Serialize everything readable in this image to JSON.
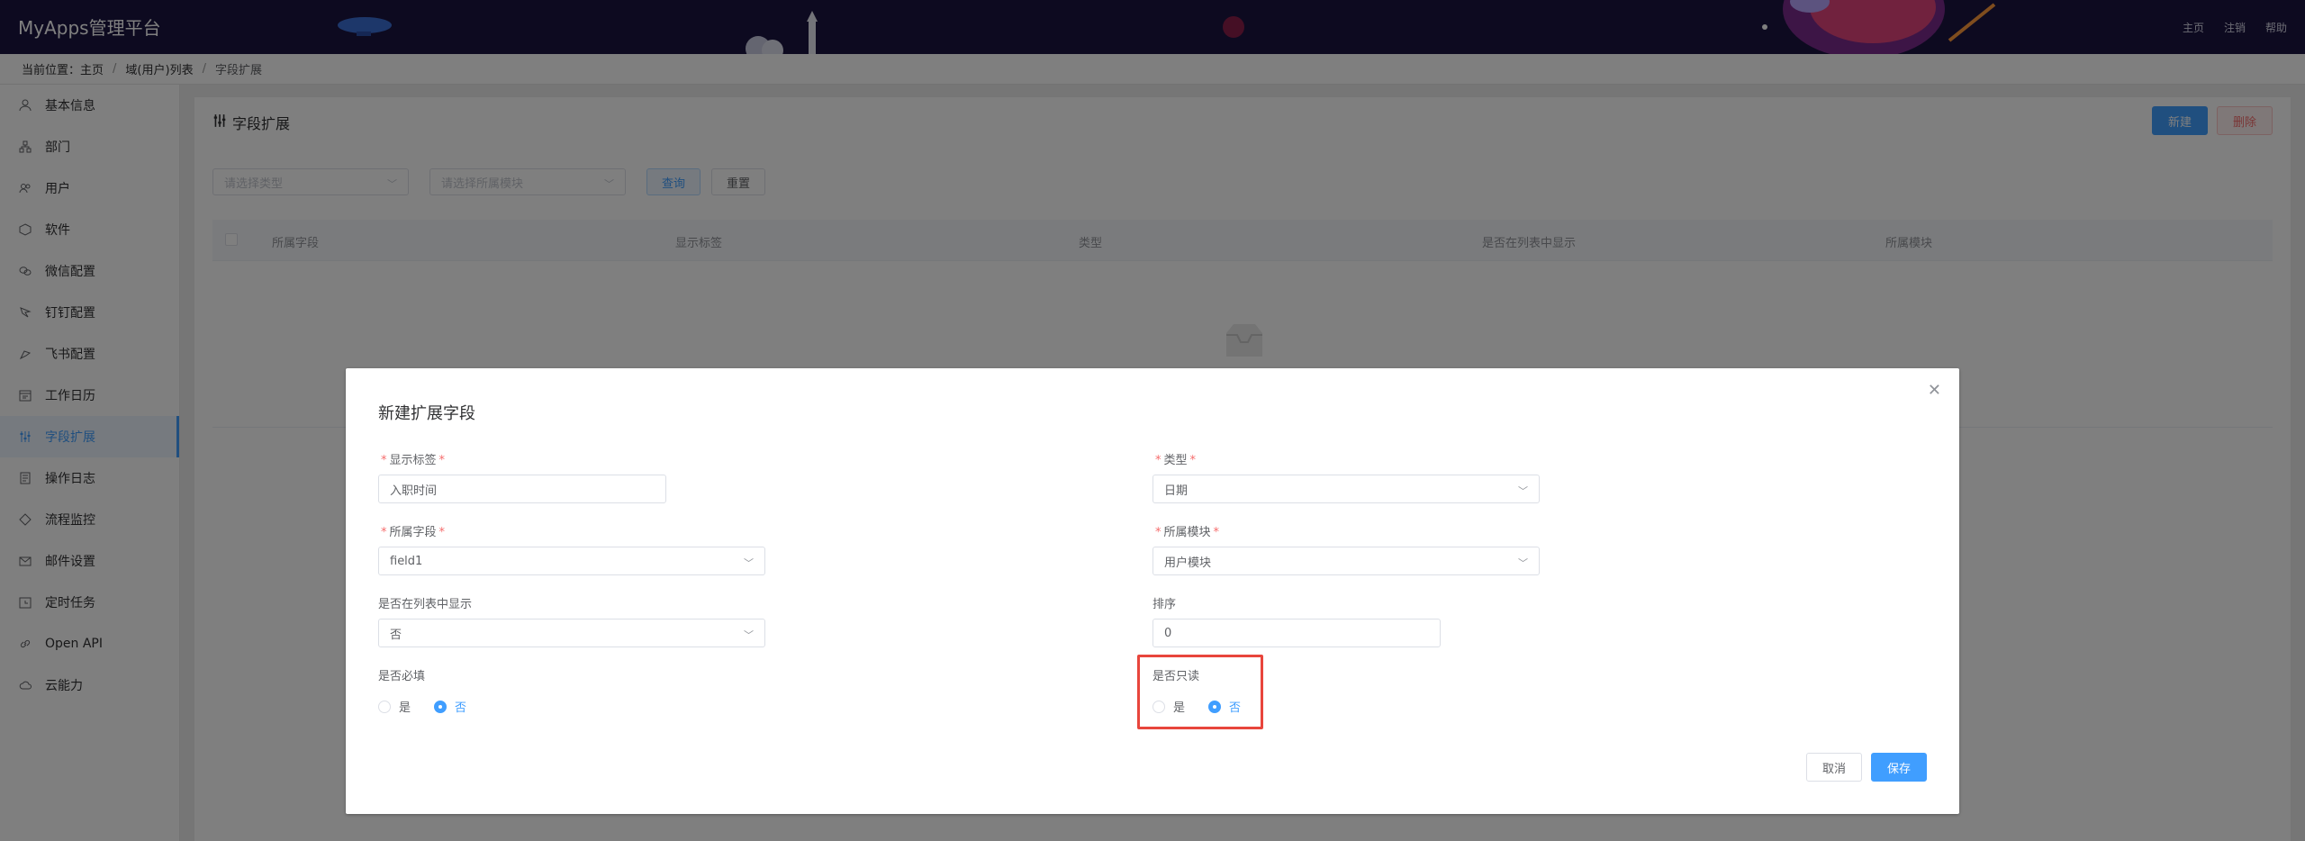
{
  "header": {
    "brand": "MyApps管理平台",
    "links": [
      "主页",
      "注销",
      "帮助"
    ]
  },
  "breadcrumb": {
    "prefix": "当前位置：",
    "items": [
      "主页",
      "域(用户)列表",
      "字段扩展"
    ]
  },
  "sidebar": {
    "items": [
      {
        "label": "基本信息",
        "icon": "person-icon"
      },
      {
        "label": "部门",
        "icon": "org-icon"
      },
      {
        "label": "用户",
        "icon": "users-icon"
      },
      {
        "label": "软件",
        "icon": "cube-icon"
      },
      {
        "label": "微信配置",
        "icon": "wechat-icon"
      },
      {
        "label": "钉钉配置",
        "icon": "dingtalk-icon"
      },
      {
        "label": "飞书配置",
        "icon": "feishu-icon"
      },
      {
        "label": "工作日历",
        "icon": "calendar-icon"
      },
      {
        "label": "字段扩展",
        "icon": "sliders-icon",
        "active": true
      },
      {
        "label": "操作日志",
        "icon": "log-icon"
      },
      {
        "label": "流程监控",
        "icon": "flow-icon"
      },
      {
        "label": "邮件设置",
        "icon": "mail-icon"
      },
      {
        "label": "定时任务",
        "icon": "timer-icon"
      },
      {
        "label": "Open API",
        "icon": "link-icon"
      },
      {
        "label": "云能力",
        "icon": "cloud-icon"
      }
    ]
  },
  "page": {
    "title": "字段扩展",
    "new_button": "新建",
    "delete_button": "删除",
    "filter_type_placeholder": "请选择类型",
    "filter_module_placeholder": "请选择所属模块",
    "query_button": "查询",
    "reset_button": "重置",
    "columns": [
      "所属字段",
      "显示标签",
      "类型",
      "是否在列表中显示",
      "所属模块"
    ]
  },
  "dialog": {
    "title": "新建扩展字段",
    "label_field": {
      "label": "显示标签",
      "value": "入职时间"
    },
    "type_field": {
      "label": "类型",
      "value": "日期"
    },
    "belong_field": {
      "label": "所属字段",
      "value": "field1"
    },
    "module_field": {
      "label": "所属模块",
      "value": "用户模块"
    },
    "show_in_list": {
      "label": "是否在列表中显示",
      "value": "否"
    },
    "sort": {
      "label": "排序",
      "value": "0"
    },
    "required": {
      "label": "是否必填",
      "options": [
        "是",
        "否"
      ],
      "selected": "否"
    },
    "readonly": {
      "label": "是否只读",
      "options": [
        "是",
        "否"
      ],
      "selected": "否"
    },
    "cancel_button": "取消",
    "save_button": "保存"
  },
  "colors": {
    "primary": "#409eff",
    "danger": "#f56c6c",
    "header_bg": "#1a1440",
    "highlight": "#e8453c"
  }
}
